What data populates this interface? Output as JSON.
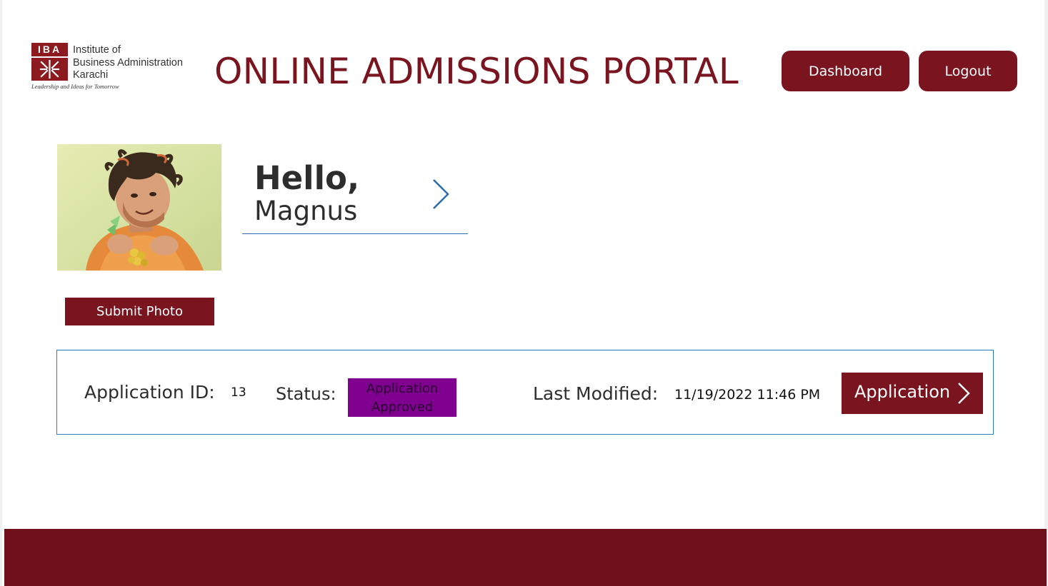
{
  "logo": {
    "badge_text": "IBA",
    "name_lines": [
      "Institute of",
      "Business Administration",
      "Karachi"
    ],
    "tagline": "Leadership and Ideas for Tomorrow",
    "brand_color": "#8c1a1f"
  },
  "header": {
    "title": "ONLINE ADMISSIONS PORTAL",
    "dashboard_label": "Dashboard",
    "logout_label": "Logout",
    "accent_color": "#7a1520"
  },
  "profile": {
    "greeting": "Hello,",
    "name": "Magnus",
    "chevron_icon": "chevron-right-icon",
    "submit_photo_label": "Submit Photo"
  },
  "application": {
    "id_label": "Application ID:",
    "id_value": "13",
    "status_label": "Status:",
    "status_value": "Application Approved",
    "status_color": "#800090",
    "last_modified_label": "Last Modified:",
    "last_modified_value": "11/19/2022 11:46 PM",
    "button_label": "Application",
    "button_icon": "chevron-right-icon"
  },
  "footer": {
    "color": "#6f101a"
  }
}
